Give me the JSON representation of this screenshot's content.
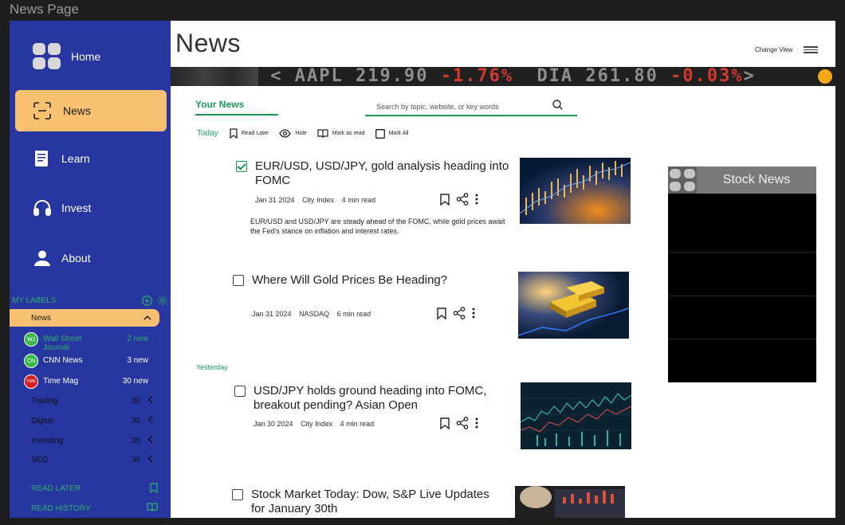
{
  "window": {
    "title": "News Page"
  },
  "sidebar": {
    "nav": [
      {
        "label": "Home",
        "icon": "grid-icon"
      },
      {
        "label": "News",
        "icon": "scan-icon",
        "active": true
      },
      {
        "label": "Learn",
        "icon": "book-icon"
      },
      {
        "label": "Invest",
        "icon": "headset-icon"
      },
      {
        "label": "About",
        "icon": "user-icon"
      }
    ],
    "labels_header": "MY LABELS",
    "labels": [
      {
        "name": "News",
        "active": true
      }
    ],
    "sources": [
      {
        "badge": "WJ",
        "name": "Wall Street Journal",
        "count": "2 new",
        "color": "#3bb84a"
      },
      {
        "badge": "CN",
        "name": "CNN News",
        "count": "3 new",
        "color": "#3bb84a"
      },
      {
        "badge": "TIME",
        "name": "Time Mag",
        "count": "30 new",
        "color": "#d81e1e"
      }
    ],
    "categories": [
      {
        "name": "Trading",
        "count": "30"
      },
      {
        "name": "Digital",
        "count": "30"
      },
      {
        "name": "Investing",
        "count": "30"
      },
      {
        "name": "SEO",
        "count": "30"
      }
    ],
    "footer": [
      {
        "name": "READ LATER",
        "icon": "bookmark-icon"
      },
      {
        "name": "READ HISTORY",
        "icon": "open-book-icon"
      }
    ]
  },
  "main": {
    "title": "News",
    "change_view": "Change View",
    "ticker": {
      "items": [
        {
          "symbol": "AAPL 219.90",
          "change": "-1.76%"
        },
        {
          "symbol": "DIA 261.80",
          "change": "-0.03%"
        }
      ]
    },
    "tab": "Your News",
    "search_placeholder": "Search by topic, website, or key words",
    "toolbar": {
      "today": "Today",
      "read_later": "Read Later",
      "hide": "Hide",
      "mark_as_read": "Mark as read",
      "mark_all": "Mark All"
    },
    "sections": {
      "today": "Today",
      "yesterday": "Yesterday"
    },
    "articles": [
      {
        "title": "EUR/USD, USD/JPY, gold analysis heading into FOMC",
        "date": "Jan 31 2024",
        "source": "City Index",
        "read_time": "4 min read",
        "description": "EUR/USD and USD/JPY are steady ahead of the FOMC, while gold prices await the Fed's stance on inflation and interest rates.",
        "checked": true
      },
      {
        "title": "Where Will Gold Prices Be Heading?",
        "date": "Jan 31 2024",
        "source": "NASDAQ",
        "read_time": "6 min read"
      },
      {
        "title": "USD/JPY holds ground heading into FOMC, breakout pending? Asian Open",
        "date": "Jan 30 2024",
        "source": "City Index",
        "read_time": "4 min read"
      },
      {
        "title": "Stock Market Today: Dow, S&P Live Updates for January 30th"
      }
    ]
  },
  "stock_widget": {
    "title": "Stock News"
  },
  "colors": {
    "sidebar": "#2736a0",
    "accent": "#f8c070",
    "green": "#1b9a55",
    "ticker_red": "#d23a2c"
  }
}
